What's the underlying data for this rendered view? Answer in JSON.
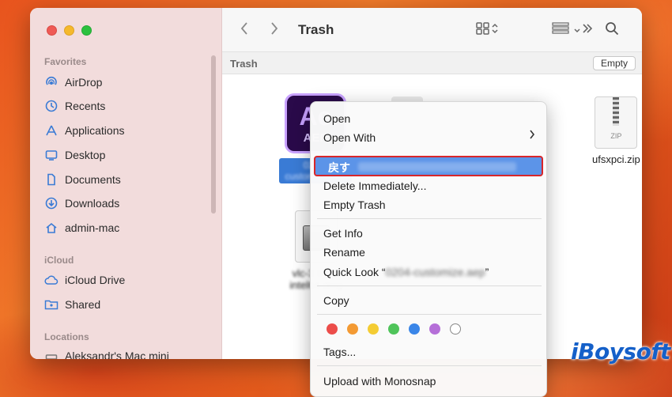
{
  "window": {
    "title": "Trash",
    "path_label": "Trash",
    "empty_button": "Empty"
  },
  "sidebar": {
    "favorites_heading": "Favorites",
    "favorites": [
      {
        "label": "AirDrop",
        "icon": "airdrop-icon"
      },
      {
        "label": "Recents",
        "icon": "clock-icon"
      },
      {
        "label": "Applications",
        "icon": "applications-icon"
      },
      {
        "label": "Desktop",
        "icon": "desktop-icon"
      },
      {
        "label": "Documents",
        "icon": "document-icon"
      },
      {
        "label": "Downloads",
        "icon": "download-icon"
      },
      {
        "label": "admin-mac",
        "icon": "home-icon"
      }
    ],
    "icloud_heading": "iCloud",
    "icloud": [
      {
        "label": "iCloud Drive",
        "icon": "cloud-icon"
      },
      {
        "label": "Shared",
        "icon": "shared-folder-icon"
      }
    ],
    "locations_heading": "Locations",
    "locations": [
      {
        "label": "Aleksandr's Mac mini",
        "icon": "computer-icon"
      }
    ]
  },
  "files": {
    "aep": {
      "icon_big": "Ae",
      "icon_small": "AEP",
      "label": "0204-customize.aep"
    },
    "zip": {
      "icon_text": "ZIP",
      "label": "ufsxpci.zip"
    },
    "dmg": {
      "label": "vlc-3.0.18-intel64.dmg"
    }
  },
  "context_menu": {
    "open": "Open",
    "open_with": "Open With",
    "put_back": "戻す",
    "delete_immediately": "Delete Immediately...",
    "empty_trash": "Empty Trash",
    "get_info": "Get Info",
    "rename": "Rename",
    "quick_look_prefix": "Quick Look “",
    "quick_look_file": "0204-customize.aep",
    "quick_look_suffix": "”",
    "copy": "Copy",
    "tags": "Tags...",
    "upload": "Upload with Monosnap",
    "tag_colors": [
      "#ec4d4a",
      "#f39a33",
      "#f4cc33",
      "#4fc45a",
      "#3a86e8",
      "#b56fd8"
    ]
  },
  "brand": "iBoysoft"
}
